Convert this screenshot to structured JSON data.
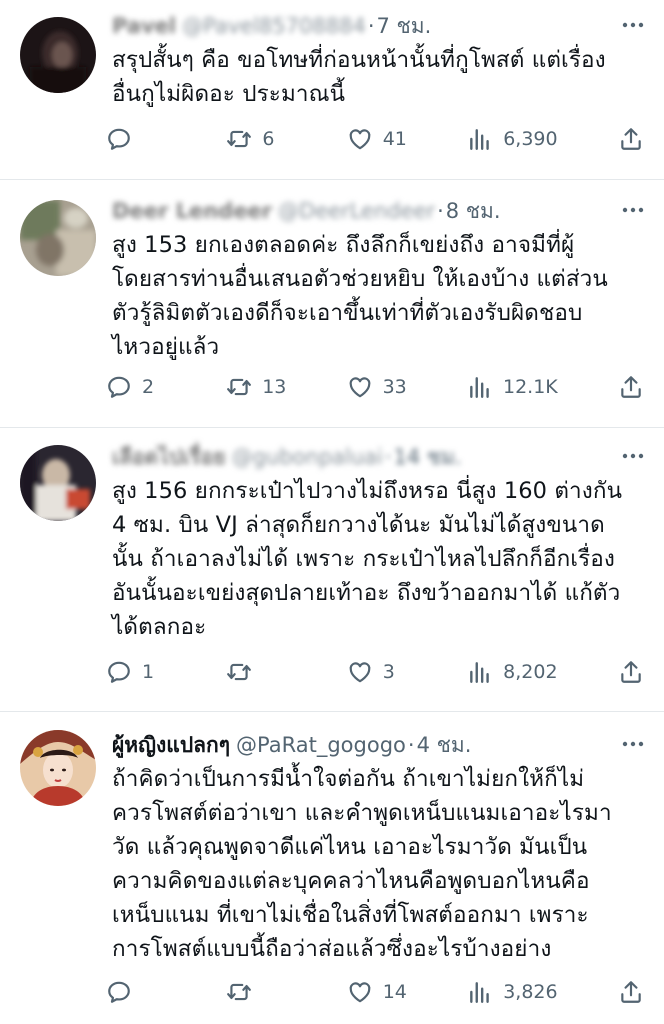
{
  "tweets": [
    {
      "name": "Pavel",
      "handle": "@Pavel85708884",
      "time": "7 ชม.",
      "text": "สรุปสั้นๆ คือ ขอโทษที่ก่อนหน้านั้นที่กูโพสต์ แต่เรื่อง\nอื่นกูไม่ผิดอะ ประมาณนี้",
      "replies": "",
      "retweets": "6",
      "likes": "41",
      "views": "6,390"
    },
    {
      "name": "Deer Lendeer",
      "handle": "@DeerLendeer",
      "time": "8 ชม.",
      "text": "สูง 153 ยกเองตลอดค่ะ ถึงลึกก็เขย่งถึง อาจมีที่ผู้\nโดยสารท่านอื่นเสนอตัวช่วยหยิบ ให้เองบ้าง แต่ส่วน\nตัวรู้ลิมิตตัวเองดีก็จะเอาขึ้นเท่าที่ตัวเองรับผิดชอบ\nไหวอยู่แล้ว",
      "replies": "2",
      "retweets": "13",
      "likes": "33",
      "views": "12.1K"
    },
    {
      "name": "เลือดไปเรื่อย",
      "handle": "@gubonpaluai",
      "time": "14 ชม.",
      "text": "สูง 156 ยกกระเป๋าไปวางไม่ถึงหรอ นี่สูง 160 ต่างกัน\n4 ซม. บิน VJ ล่าสุดก็ยกวางได้นะ มันไม่ได้สูงขนาด\nนั้น ถ้าเอาลงไม่ได้ เพราะ กระเป๋าไหลไปลึกก็อีกเรื่อง\nอันนั้นอะเขย่งสุดปลายเท้าอะ ถึงขว้าออกมาได้ แก้ตัว\nได้ตลกอะ",
      "replies": "1",
      "retweets": "",
      "likes": "3",
      "views": "8,202"
    },
    {
      "name": "ผู้หญิงแปลกๆ",
      "handle": "@PaRat_gogogo",
      "time": "4 ชม.",
      "text": "ถ้าคิดว่าเป็นการมีน้ำใจต่อกัน ถ้าเขาไม่ยกให้ก็ไม่\nควรโพสต์ต่อว่าเขา และคำพูดเหน็บแนมเอาอะไรมา\nวัด แล้วคุณพูดจาดีแค่ไหน เอาอะไรมาวัด มันเป็น\nความคิดของแต่ละบุคคลว่าไหนคือพูดบอกไหนคือ\nเหน็บแนม ที่เขาไม่เชื่อในสิ่งที่โพสต์ออกมา เพราะ\nการโพสต์แบบนี้ถือว่าส่อแล้วซึ่งอะไรบ้างอย่าง",
      "replies": "",
      "retweets": "",
      "likes": "14",
      "views": "3,826"
    }
  ],
  "colors": {
    "icon": "#536471",
    "text": "#0f1419",
    "divider": "#e4e8eb"
  },
  "icons": [
    "reply-icon",
    "retweet-icon",
    "like-icon",
    "views-icon",
    "share-icon",
    "more-icon"
  ]
}
